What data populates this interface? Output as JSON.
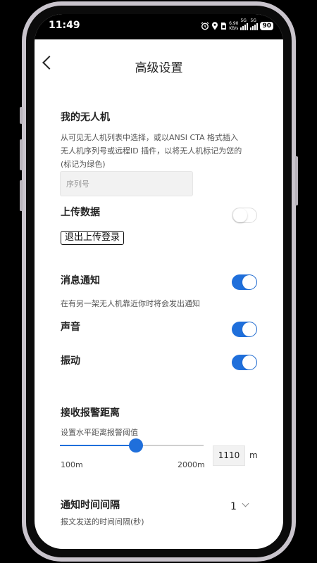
{
  "status": {
    "time": "11:49",
    "speed_value": "6.90",
    "speed_unit": "KB/s",
    "network1": "5G",
    "network2": "5G",
    "battery": "90"
  },
  "header": {
    "title": "高级设置"
  },
  "my_drone": {
    "title": "我的无人机",
    "description_line1": "从可见无人机列表中选择，或以ANSI CTA 格式插入",
    "description_line2": "无人机序列号或远程ID 插件，以将无人机标记为您的",
    "description_line3": "(标记为绿色)",
    "serial_value": "",
    "serial_placeholder": "序列号"
  },
  "upload": {
    "label": "上传数据",
    "enabled": false,
    "logout_label": "退出上传登录"
  },
  "notification": {
    "label": "消息通知",
    "enabled": true,
    "description": "在有另一架无人机靠近你时将会发出通知",
    "sound_label": "声音",
    "sound_enabled": true,
    "vibration_label": "振动",
    "vibration_enabled": true
  },
  "alarm": {
    "title": "接收报警距离",
    "description": "设置水平距离报警阈值",
    "min_label": "100m",
    "max_label": "2000m",
    "min": 100,
    "max": 2000,
    "value": "1110",
    "unit": "m"
  },
  "interval": {
    "title": "通知时间间隔",
    "description": "报文发送的时间间隔(秒)",
    "value": "1"
  },
  "colors": {
    "accent": "#1f6fdb",
    "toggle_off": "#ffffff",
    "frame": "#c9c4cc"
  }
}
